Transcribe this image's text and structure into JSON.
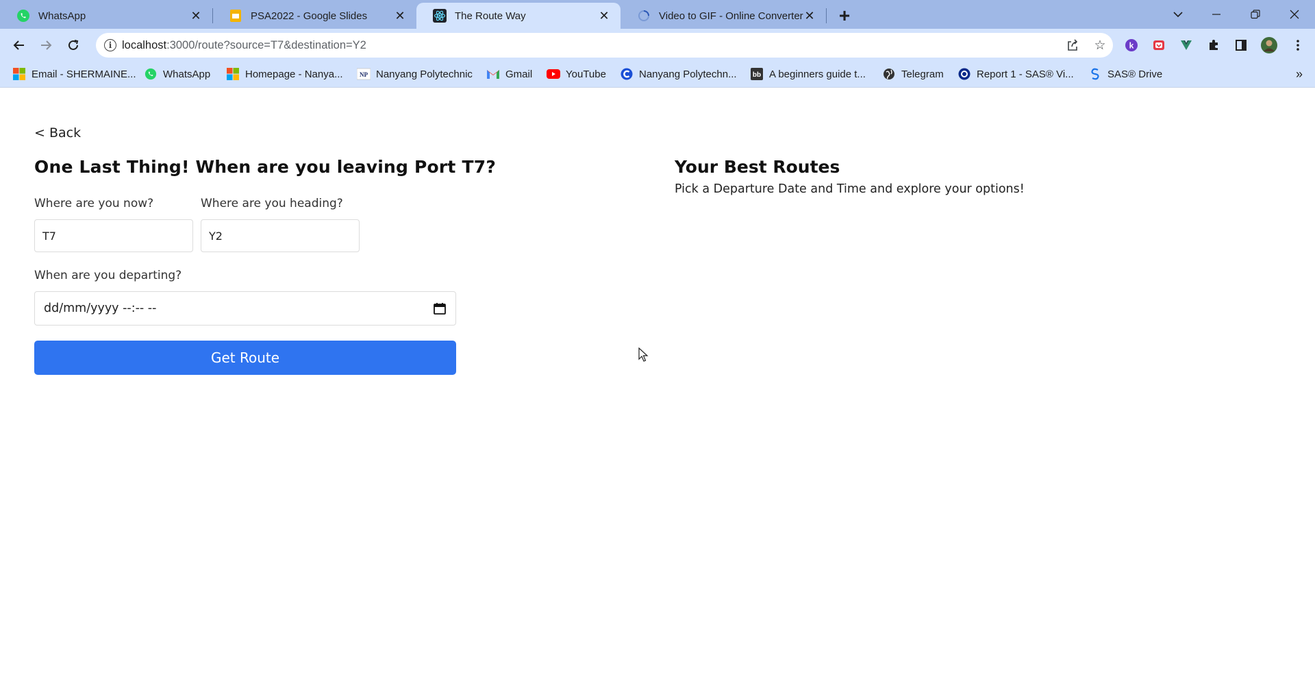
{
  "browser": {
    "tabs": [
      {
        "label": "WhatsApp",
        "icon": "whatsapp-icon",
        "active": false
      },
      {
        "label": "PSA2022 - Google Slides",
        "icon": "google-slides-icon",
        "active": false
      },
      {
        "label": "The Route Way",
        "icon": "react-icon",
        "active": true
      },
      {
        "label": "Video to GIF - Online Converter",
        "icon": "loading-icon",
        "active": false
      }
    ],
    "url_host": "localhost",
    "url_path": ":3000/route?source=T7&destination=Y2",
    "bookmarks": [
      {
        "label": "Email - SHERMAINE...",
        "icon": "microsoft-icon"
      },
      {
        "label": "WhatsApp",
        "icon": "whatsapp-icon"
      },
      {
        "label": "Homepage - Nanya...",
        "icon": "microsoft-icon"
      },
      {
        "label": "Nanyang Polytechnic",
        "icon": "nyp-icon"
      },
      {
        "label": "Gmail",
        "icon": "gmail-icon"
      },
      {
        "label": "YouTube",
        "icon": "youtube-icon"
      },
      {
        "label": "Nanyang Polytechn...",
        "icon": "c-logo-icon"
      },
      {
        "label": "A beginners guide t...",
        "icon": "bb-icon"
      },
      {
        "label": "Telegram",
        "icon": "globe-icon"
      },
      {
        "label": "Report 1 - SAS® Vi...",
        "icon": "sas-viya-icon"
      },
      {
        "label": "SAS® Drive",
        "icon": "sas-icon"
      }
    ]
  },
  "page": {
    "back_label": "< Back",
    "title": "One Last Thing! When are you leaving Port T7?",
    "source_label": "Where are you now?",
    "source_value": "T7",
    "destination_label": "Where are you heading?",
    "destination_value": "Y2",
    "departing_label": "When are you departing?",
    "datetime_placeholder": "dd/mm/yyyy --:-- --",
    "submit_label": "Get Route",
    "results_title": "Your Best Routes",
    "results_subtitle": "Pick a Departure Date and Time and explore your options!"
  },
  "colors": {
    "tabstrip": "#9fb8e6",
    "toolbar": "#d3e3fd",
    "primary_button": "#2f74f0"
  }
}
